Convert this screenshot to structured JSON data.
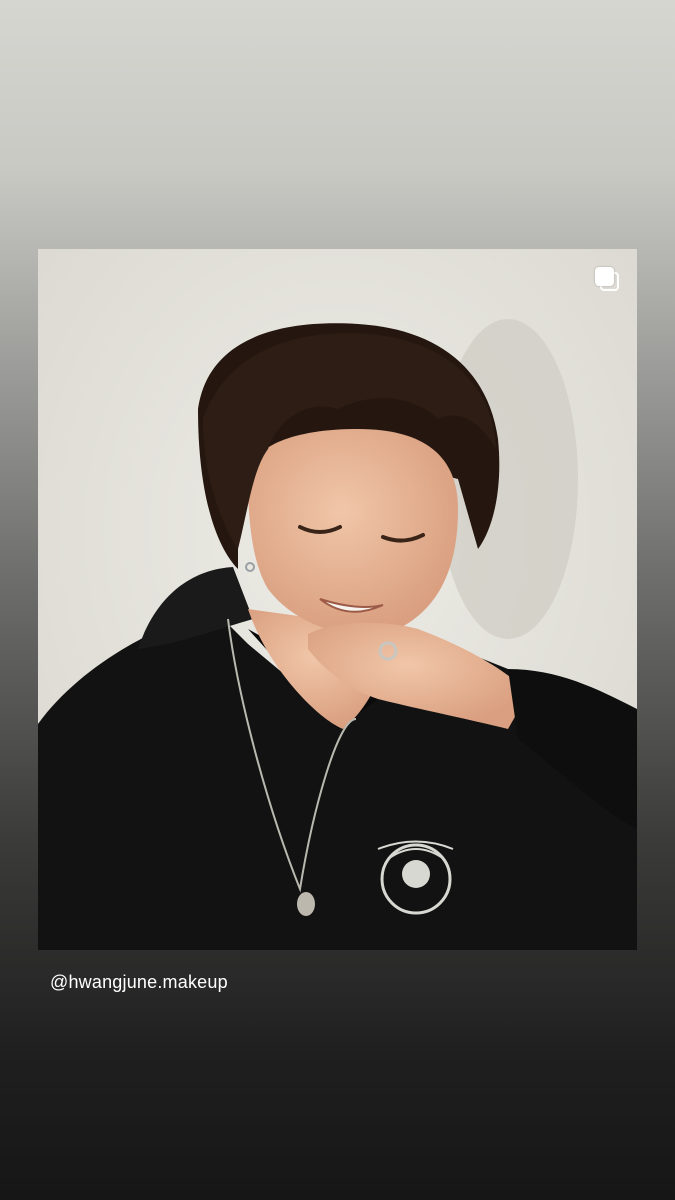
{
  "story": {
    "mention": "@hwangjune.makeup",
    "post": {
      "photo_subject": "person-laughing-black-hoodie",
      "multi_post_icon": "carousel-icon"
    }
  },
  "colors": {
    "background_top": "#d6d6d1",
    "background_bottom": "#161616",
    "photo_wall": "#e4e2db",
    "hoodie": "#111111",
    "hair": "#2a1b17",
    "skin": "#e8b89a",
    "mention_text": "#ffffff"
  }
}
